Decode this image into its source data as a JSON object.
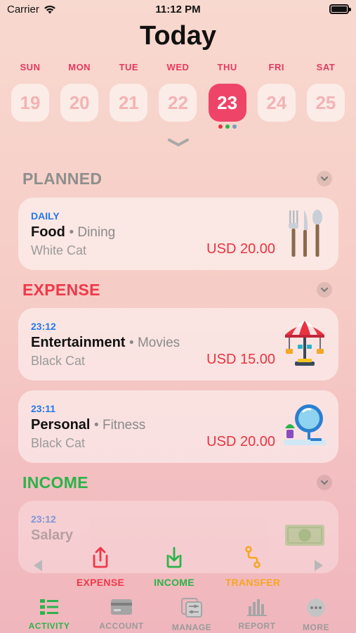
{
  "status_bar": {
    "carrier": "Carrier",
    "time": "11:12 PM"
  },
  "header": {
    "title": "Today"
  },
  "week": [
    {
      "day": "SUN",
      "date": "19"
    },
    {
      "day": "MON",
      "date": "20"
    },
    {
      "day": "TUE",
      "date": "21"
    },
    {
      "day": "WED",
      "date": "22"
    },
    {
      "day": "THU",
      "date": "23",
      "selected": true
    },
    {
      "day": "FRI",
      "date": "24"
    },
    {
      "day": "SAT",
      "date": "25"
    }
  ],
  "selected_day_dots": [
    "#e8333f",
    "#2bb34a",
    "#7a9bb8"
  ],
  "sections": {
    "planned": {
      "title": "PLANNED",
      "color": "#8e8e8e"
    },
    "expense": {
      "title": "EXPENSE",
      "color": "#f0384a"
    },
    "income": {
      "title": "INCOME",
      "color": "#2bb34a"
    }
  },
  "planned_items": [
    {
      "when": "DAILY",
      "name": "Food",
      "category": "• Dining",
      "account": "White Cat",
      "amount": "USD 20.00",
      "icon": "cutlery-icon"
    }
  ],
  "expense_items": [
    {
      "when": "23:12",
      "name": "Entertainment",
      "category": "• Movies",
      "account": "Black Cat",
      "amount": "USD 15.00",
      "icon": "carousel-icon"
    },
    {
      "when": "23:11",
      "name": "Personal",
      "category": "• Fitness",
      "account": "Black Cat",
      "amount": "USD 20.00",
      "icon": "mirror-icon"
    }
  ],
  "income_items": [
    {
      "when": "23:12",
      "name": "Salary",
      "icon": "cash-icon"
    }
  ],
  "actions": {
    "expense": {
      "label": "EXPENSE",
      "color": "#f0384a"
    },
    "income": {
      "label": "INCOME",
      "color": "#2bb34a"
    },
    "transfer": {
      "label": "TRANSFER",
      "color": "#f5a623"
    }
  },
  "tabs": [
    {
      "label": "ACTIVITY",
      "icon": "list-icon",
      "active": true
    },
    {
      "label": "ACCOUNT",
      "icon": "card-icon"
    },
    {
      "label": "MANAGE",
      "icon": "sliders-icon"
    },
    {
      "label": "REPORT",
      "icon": "bar-chart-icon"
    },
    {
      "label": "MORE",
      "icon": "more-icon"
    }
  ]
}
